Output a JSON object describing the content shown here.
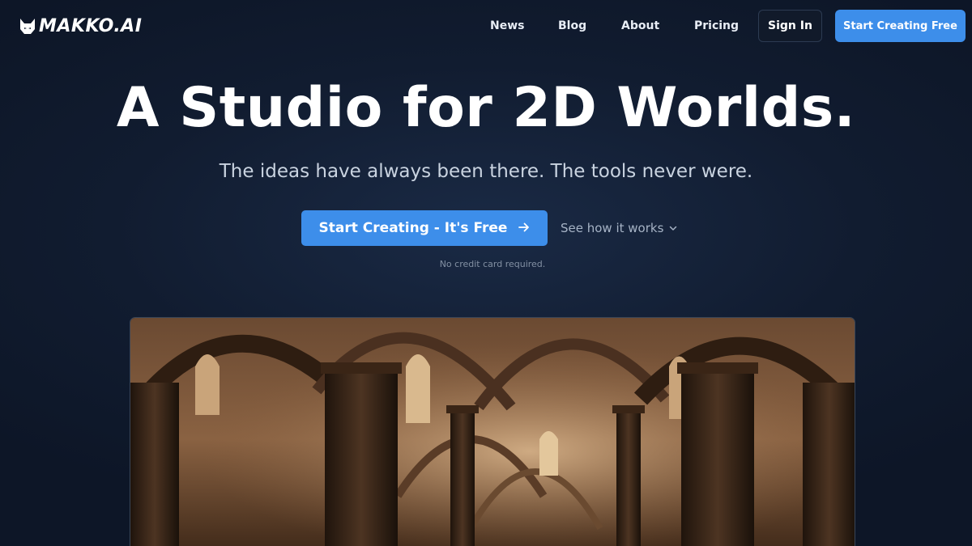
{
  "nav": {
    "logo_text": "MAKKO.AI",
    "links": [
      "News",
      "Blog",
      "About",
      "Pricing"
    ],
    "sign_in_label": "Sign In",
    "start_label": "Start Creating Free"
  },
  "hero": {
    "title": "A Studio for 2D Worlds.",
    "subtitle": "The ideas have always been there. The tools never were.",
    "cta_primary": "Start Creating - It's Free",
    "cta_secondary": "See how it works",
    "note": "No credit card required."
  },
  "icons": {
    "logo": "cat-head-icon",
    "cta_arrow": "arrow-right-icon",
    "cta_secondary": "chevron-down-icon"
  },
  "colors": {
    "accent": "#3d8eea",
    "background": "#111c30"
  }
}
